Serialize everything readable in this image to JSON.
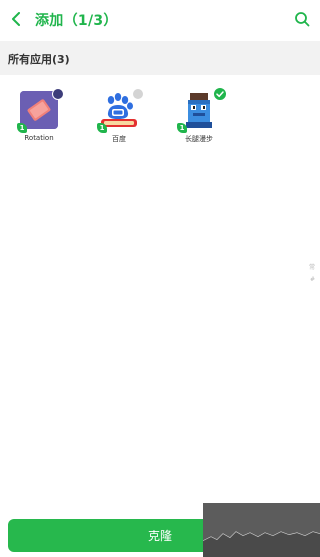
{
  "header": {
    "title": "添加（1/3）",
    "accent_color": "#20b54c"
  },
  "section": {
    "title": "所有应用(3)"
  },
  "apps": [
    {
      "label": "Rotation",
      "count": "1",
      "status": "unselected"
    },
    {
      "label": "百度",
      "count": "1",
      "status": "unselected"
    },
    {
      "label": "长腿漫步",
      "count": "1",
      "status": "selected"
    }
  ],
  "edge_markers": [
    "常",
    "#"
  ],
  "bottom": {
    "clone_label": "克隆",
    "button_color": "#27b84d"
  },
  "icons": {
    "back": "chevron-left-icon",
    "search": "search-icon",
    "check": "check-icon"
  }
}
